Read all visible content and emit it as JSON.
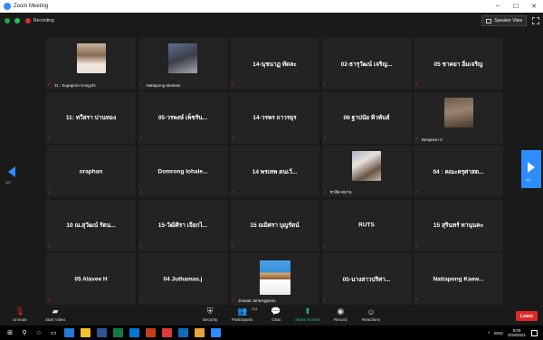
{
  "window": {
    "title": "Zoom Meeting",
    "minimize": "–",
    "maximize": "☐",
    "close": "✕"
  },
  "topbar": {
    "recording_label": "Recording",
    "speaker_view_label": "Speaker View"
  },
  "pagination": {
    "left": "1/2",
    "right": "1/2"
  },
  "participants": [
    {
      "name": "",
      "label": "11 : Supaporn Kongchi",
      "photo": "p1"
    },
    {
      "name": "",
      "label": "Nattapong Mankee",
      "photo": "p2"
    },
    {
      "name": "14-นุชนาฏ ทัดละ",
      "label": ""
    },
    {
      "name": "02-ธารุวัฒน์ เจริญ...",
      "label": ""
    },
    {
      "name": "05 ชาคยา อิ่มเจริญ",
      "label": ""
    },
    {
      "name": "11: ทวีสรา ปานทอง",
      "label": ""
    },
    {
      "name": "05-วรพงษ์ เพ็ชรัน...",
      "label": ""
    },
    {
      "name": "14-วรพร ถาวรยุร",
      "label": ""
    },
    {
      "name": "06 ฐาปนัย พิวพันธ์",
      "label": ""
    },
    {
      "name": "",
      "label": "Benjamin C",
      "photo": "p3"
    },
    {
      "name": "oraphan",
      "label": ""
    },
    {
      "name": "Domrong Iohale...",
      "label": ""
    },
    {
      "name": "14 พรเทพ คนเว้...",
      "label": ""
    },
    {
      "name": "",
      "label": "ชาลิต คมาน",
      "photo": "p4"
    },
    {
      "name": "04 : คณะครุศาสต...",
      "label": ""
    },
    {
      "name": "10 ณ.สุวัฒน์ รัตน...",
      "label": ""
    },
    {
      "name": "15-วัฒิศิรา เจียกไ...",
      "label": ""
    },
    {
      "name": "15 ณมิศรา บุญรัตน์",
      "label": ""
    },
    {
      "name": "RUTS",
      "label": ""
    },
    {
      "name": "15 สุรินทร์ ทานุนคะ",
      "label": ""
    },
    {
      "name": "05 Alavee H",
      "label": ""
    },
    {
      "name": "04 Juthamas.j",
      "label": ""
    },
    {
      "name": "",
      "label": "Jirawat Jantongpoon",
      "photo": "p5"
    },
    {
      "name": "05-นางสาวปริศา...",
      "label": ""
    },
    {
      "name": "Nattapong Kaew...",
      "label": ""
    }
  ],
  "toolbar": {
    "unmute": "Unmute",
    "start_video": "Start Video",
    "security": "Security",
    "participants": "Participants",
    "participants_count": "231",
    "chat": "Chat",
    "share_screen": "Share Screen",
    "record": "Record",
    "reactions": "Reactions",
    "leave": "Leave"
  },
  "taskbar": {
    "lang": "ENG",
    "time": "9:00",
    "date": "3/18/2021"
  },
  "colors": {
    "accent": "#2d8cff",
    "mute_red": "#e02828",
    "share_green": "#23c45e"
  }
}
